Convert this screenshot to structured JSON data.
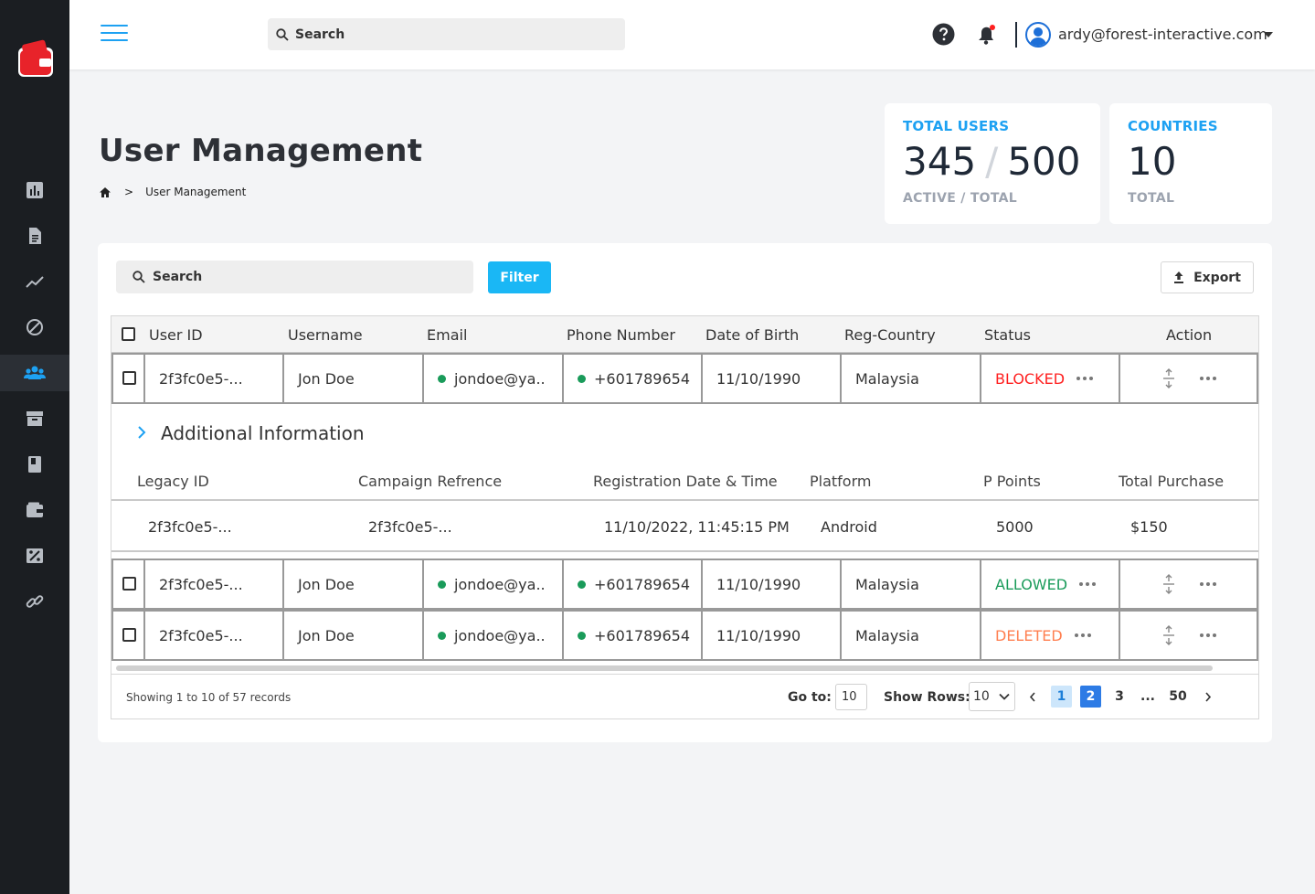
{
  "topbar": {
    "search_placeholder": "Search",
    "user_email": "ardy@forest-interactive.com"
  },
  "page": {
    "title": "User Management",
    "breadcrumb_current": "User Management",
    "breadcrumb_separator": ">"
  },
  "stats": {
    "total_users": {
      "title": "TOTAL USERS",
      "active": "345",
      "slash": "/",
      "total": "500",
      "sub": "ACTIVE / TOTAL"
    },
    "countries": {
      "title": "COUNTRIES",
      "value": "10",
      "sub": "TOTAL"
    }
  },
  "toolbar": {
    "search_placeholder": "Search",
    "filter_label": "Filter",
    "export_label": "Export"
  },
  "table": {
    "columns": [
      "User ID",
      "Username",
      "Email",
      "Phone Number",
      "Date of Birth",
      "Reg-Country",
      "Status",
      "Action"
    ],
    "rows": [
      {
        "user_id": "2f3fc0e5-...",
        "username": "Jon Doe",
        "email": "jondoe@ya..",
        "phone": "+601789654",
        "dob": "11/10/1990",
        "country": "Malaysia",
        "status": "BLOCKED",
        "status_color": "#ff1f1f"
      },
      {
        "user_id": "2f3fc0e5-...",
        "username": "Jon Doe",
        "email": "jondoe@ya..",
        "phone": "+601789654",
        "dob": "11/10/1990",
        "country": "Malaysia",
        "status": "ALLOWED",
        "status_color": "#1a9b5a"
      },
      {
        "user_id": "2f3fc0e5-...",
        "username": "Jon Doe",
        "email": "jondoe@ya..",
        "phone": "+601789654",
        "dob": "11/10/1990",
        "country": "Malaysia",
        "status": "DELETED",
        "status_color": "#ff7f50"
      }
    ],
    "additional": {
      "title": "Additional Information",
      "columns": [
        "Legacy ID",
        "Campaign Refrence",
        "Registration Date & Time",
        "Platform",
        "P Points",
        "Total Purchase"
      ],
      "values": [
        "2f3fc0e5-...",
        "2f3fc0e5-...",
        "11/10/2022, 11:45:15 PM",
        "Android",
        "5000",
        "$150"
      ]
    }
  },
  "pagination": {
    "showing": "Showing 1 to 10 of 57 records",
    "goto_label": "Go to:",
    "goto_value": "10",
    "rows_label": "Show Rows:",
    "rows_value": "10",
    "pages": [
      "1",
      "2",
      "3",
      "...",
      "50"
    ]
  },
  "colors": {
    "accent": "#1da1f2",
    "filter_button": "#1ab7f5",
    "sidebar": "#1b1e22",
    "logo_red": "#e8232a"
  },
  "icons": {
    "sidebar": [
      "bar-chart-icon",
      "document-icon",
      "trend-line-icon",
      "block-icon",
      "users-icon",
      "archive-icon",
      "book-icon",
      "wallet-icon",
      "percent-icon",
      "link-icon"
    ]
  }
}
